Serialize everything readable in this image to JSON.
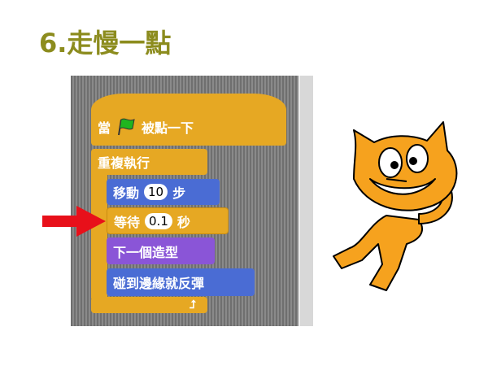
{
  "title": "6.走慢一點",
  "blocks": {
    "hat": {
      "pre": "當",
      "post": "被點一下"
    },
    "forever": "重複執行",
    "move": {
      "pre": "移動",
      "value": "10",
      "post": "步"
    },
    "wait": {
      "pre": "等待",
      "value": "0.1",
      "post": "秒"
    },
    "next_costume": "下一個造型",
    "bounce": "碰到邊緣就反彈"
  }
}
